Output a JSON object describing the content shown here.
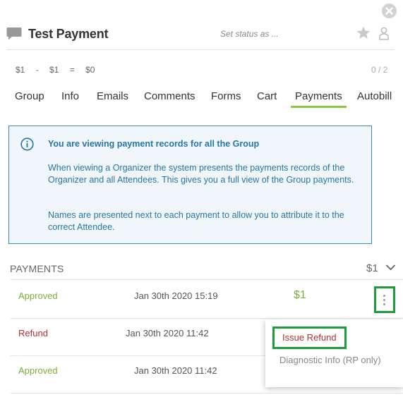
{
  "header": {
    "title": "Test Payment",
    "status_placeholder": "Set status as ...",
    "icons": [
      "chat-icon",
      "star-icon",
      "person-icon",
      "close-icon"
    ]
  },
  "summary": {
    "a": "$1",
    "op1": "-",
    "b": "$1",
    "op2": "=",
    "result": "$0",
    "count": "0 / 2"
  },
  "tabs": [
    {
      "label": "Group"
    },
    {
      "label": "Info"
    },
    {
      "label": "Emails"
    },
    {
      "label": "Comments"
    },
    {
      "label": "Forms"
    },
    {
      "label": "Cart"
    },
    {
      "label": "Payments",
      "active": true
    },
    {
      "label": "Autobill"
    }
  ],
  "info": {
    "title": "You are viewing payment records for all the Group",
    "p1": "When viewing a Organizer the system presents the payments records of the Organizer and all Attendees. This gives you a full view of the Group payments.",
    "p2": "Names are presented next to each payment to allow you to attribute it to the correct Attendee."
  },
  "payments": {
    "heading": "PAYMENTS",
    "total": "$1",
    "rows": [
      {
        "status": "Approved",
        "date": "Jan 30th 2020 15:19",
        "amount": "$1"
      },
      {
        "status": "Refund",
        "date": "Jan 30th 2020 11:42",
        "amount": ""
      },
      {
        "status": "Approved",
        "date": "Jan 30th 2020 11:42",
        "amount": ""
      }
    ]
  },
  "menu": {
    "issue_refund": "Issue Refund",
    "diagnostic": "Diagnostic Info (RP only)"
  },
  "colors": {
    "accent_green": "#8dc63f",
    "approved": "#7cae3a",
    "refund": "#b03030",
    "info_blue": "#2677a7",
    "highlight_green": "#1e9e3a"
  }
}
